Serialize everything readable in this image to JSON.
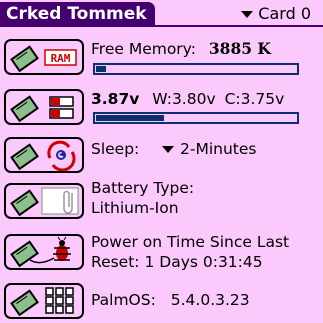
{
  "header": {
    "title": "Crked Tommek",
    "card_label": "Card 0"
  },
  "memory": {
    "label": "Free Memory:",
    "value": "3885 K",
    "bar_fraction": 0.05,
    "icon": "ram-icon"
  },
  "battery": {
    "voltage": "3.87v",
    "warn_label": "W:",
    "warn_value": "3.80v",
    "crit_label": "C:",
    "crit_value": "3.75v",
    "bar_fraction": 0.34,
    "icon": "battery-icon"
  },
  "sleep": {
    "label": "Sleep:",
    "value": "2-Minutes",
    "icon": "sleep-swirl-icon"
  },
  "battery_type": {
    "label": "Battery Type:",
    "value": "Lithium-Ion",
    "icon": "paperclip-icon"
  },
  "power_on": {
    "label": "Power on Time Since Last",
    "reset_label": "Reset:",
    "value": "1 Days 0:31:45",
    "icon": "bug-icon"
  },
  "palmos": {
    "label": "PalmOS:",
    "value": "5.4.0.3.23",
    "icon": "grid-icon"
  },
  "colors": {
    "title_bg": "#45006f",
    "background": "#fcc9fc",
    "bar": "#0a3070",
    "accent_red": "#d10000",
    "icon_green": "#8dbf8d"
  }
}
